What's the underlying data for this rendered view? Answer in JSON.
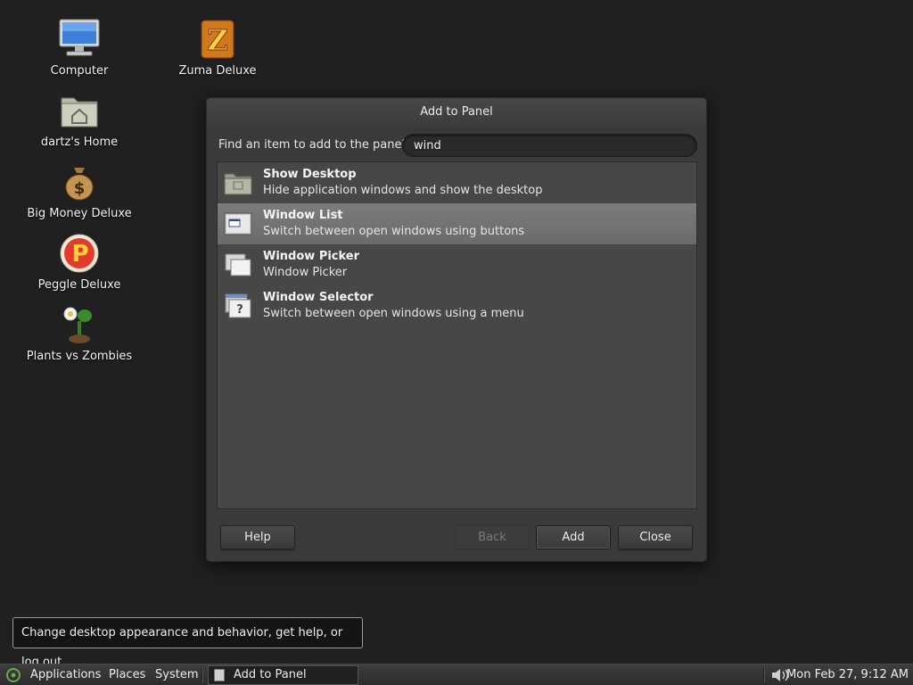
{
  "desktop": {
    "icons": [
      {
        "label": "Computer",
        "icon": "computer-icon"
      },
      {
        "label": "dartz's Home",
        "icon": "home-folder-icon"
      },
      {
        "label": "Big Money Deluxe",
        "icon": "money-bag-icon"
      },
      {
        "label": "Peggle Deluxe",
        "icon": "peggle-icon"
      },
      {
        "label": "Plants vs Zombies",
        "icon": "plant-icon"
      },
      {
        "label": "Zuma Deluxe",
        "icon": "zuma-icon"
      }
    ]
  },
  "dialog": {
    "title": "Add to Panel",
    "search_label": "Find an item to add to the panel:",
    "search_value": "wind",
    "items": [
      {
        "name": "Show Desktop",
        "desc": "Hide application windows and show the desktop",
        "icon": "show-desktop-icon",
        "selected": false
      },
      {
        "name": "Window List",
        "desc": "Switch between open windows using buttons",
        "icon": "window-list-icon",
        "selected": true
      },
      {
        "name": "Window Picker",
        "desc": "Window Picker",
        "icon": "window-picker-icon",
        "selected": false
      },
      {
        "name": "Window Selector",
        "desc": "Switch between open windows using a menu",
        "icon": "window-selector-icon",
        "selected": false
      }
    ],
    "buttons": {
      "help": "Help",
      "back": "Back",
      "add": "Add",
      "close": "Close"
    }
  },
  "tooltip": "Change desktop appearance and behavior, get help, or log out",
  "panel": {
    "menus": {
      "applications": "Applications",
      "places": "Places",
      "system": "System"
    },
    "task": "Add to Panel",
    "clock": "Mon Feb 27,  9:12 AM"
  }
}
